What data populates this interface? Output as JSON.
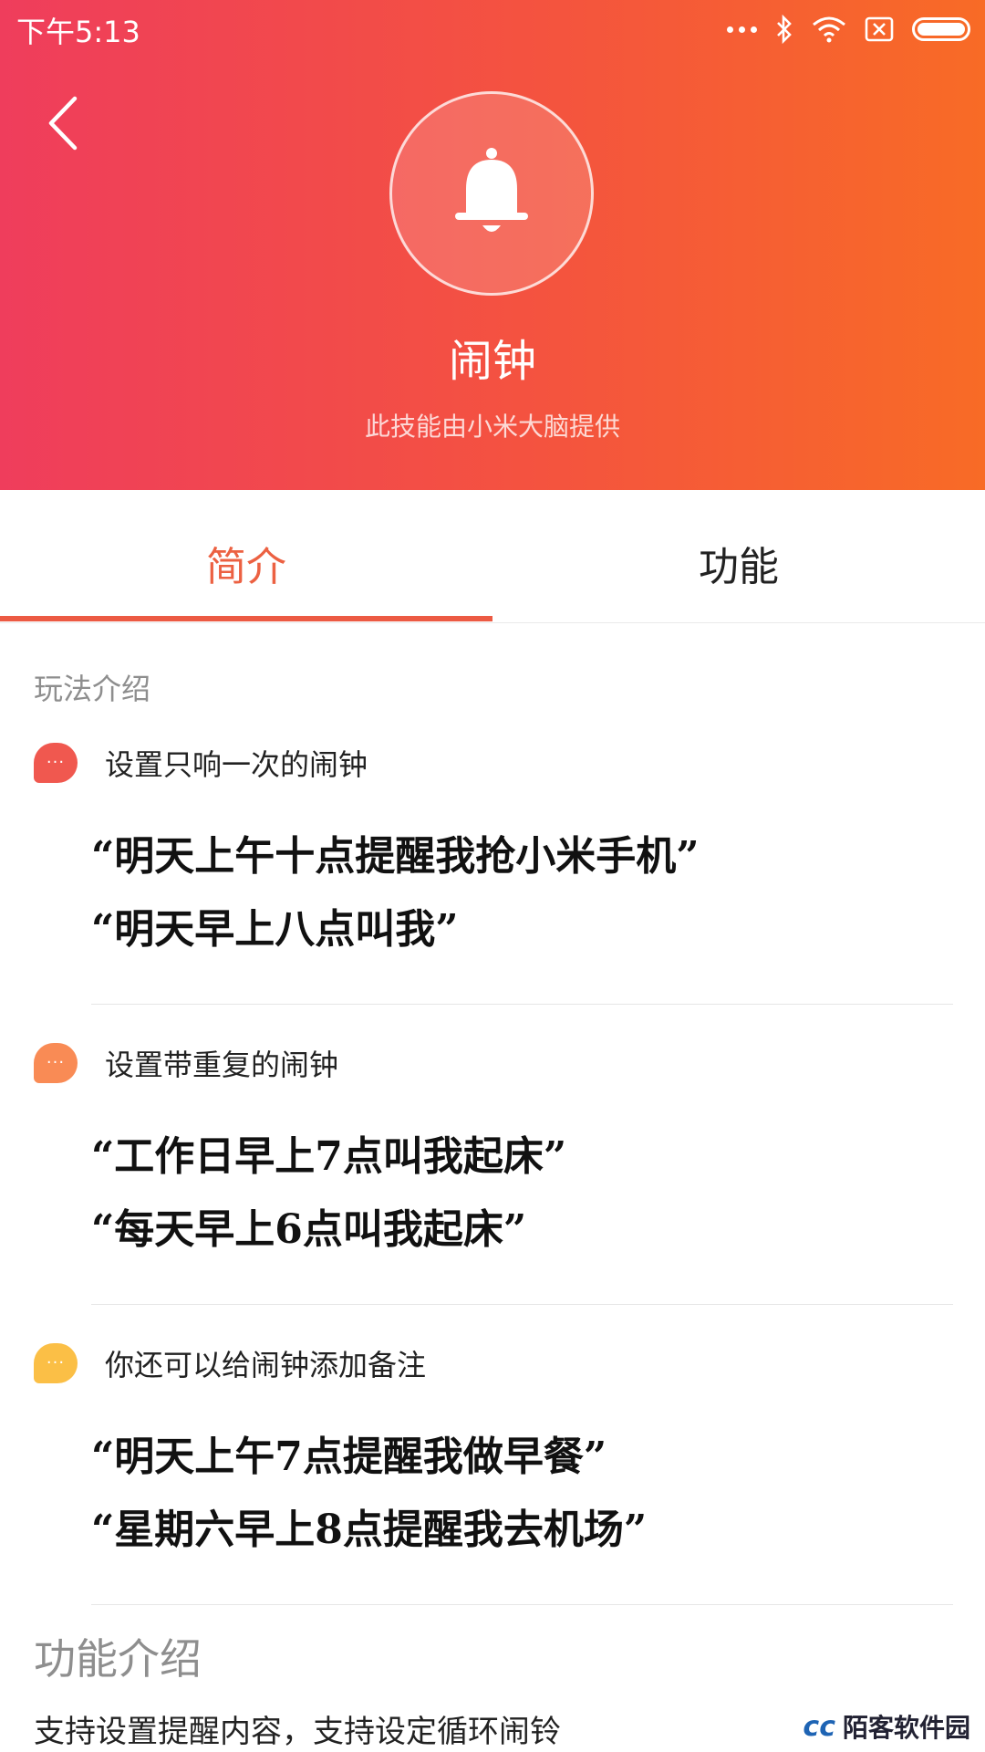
{
  "status_bar": {
    "time": "下午5:13"
  },
  "header": {
    "title": "闹钟",
    "subtitle": "此技能由小米大脑提供",
    "gradient_start": "#ef3d5c",
    "gradient_end": "#f86b26"
  },
  "tabs": [
    {
      "label": "简介",
      "active": true
    },
    {
      "label": "功能",
      "active": false
    }
  ],
  "section_label": "玩法介绍",
  "items": [
    {
      "title": "设置只响一次的闹钟",
      "bubble_color": "#f0584f",
      "examples": [
        "“明天上午十点提醒我抢小米手机”",
        "“明天早上八点叫我”"
      ]
    },
    {
      "title": "设置带重复的闹钟",
      "bubble_color": "#f98b55",
      "examples": [
        "“工作日早上7点叫我起床”",
        "“每天早上6点叫我起床”"
      ]
    },
    {
      "title": "你还可以给闹钟添加备注",
      "bubble_color": "#fbbf46",
      "examples": [
        "“明天上午7点提醒我做早餐”",
        "“星期六早上8点提醒我去机场”"
      ]
    }
  ],
  "function_intro": {
    "title": "功能介绍",
    "description": "支持设置提醒内容，支持设定循环闹铃"
  },
  "watermark": {
    "text": "陌客软件园"
  }
}
